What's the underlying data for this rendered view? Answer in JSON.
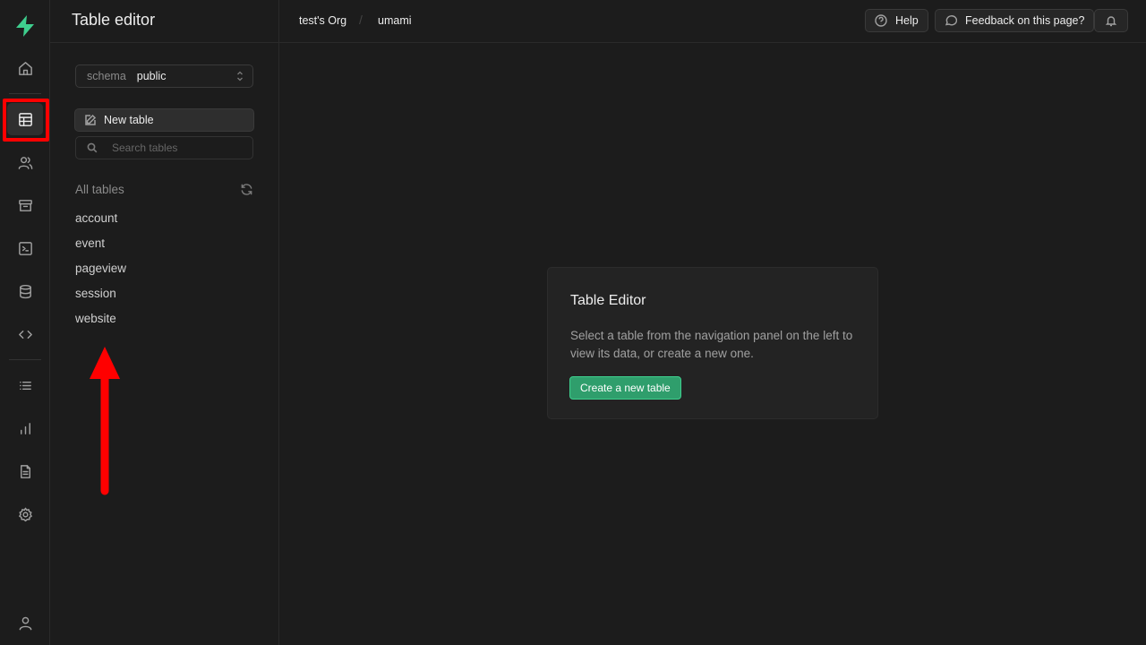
{
  "app": {
    "page_title": "Table editor"
  },
  "breadcrumb": {
    "org": "test's Org",
    "separator": "/",
    "project": "umami"
  },
  "header": {
    "help_label": "Help",
    "feedback_label": "Feedback on this page?"
  },
  "rail": {
    "items": [
      {
        "name": "home-icon"
      },
      {
        "name": "table-editor-icon",
        "active": true
      },
      {
        "name": "users-icon"
      },
      {
        "name": "storage-icon"
      },
      {
        "name": "terminal-icon"
      },
      {
        "name": "database-icon"
      },
      {
        "name": "code-icon"
      },
      {
        "name": "list-icon"
      },
      {
        "name": "reports-icon"
      },
      {
        "name": "document-icon"
      },
      {
        "name": "settings-icon"
      },
      {
        "name": "user-icon"
      }
    ]
  },
  "sidebar": {
    "schema_label": "schema",
    "schema_value": "public",
    "new_table_label": "New table",
    "search_placeholder": "Search tables",
    "all_tables_label": "All tables",
    "tables": [
      "account",
      "event",
      "pageview",
      "session",
      "website"
    ]
  },
  "empty_state": {
    "title": "Table Editor",
    "body": "Select a table from the navigation panel on the left to view its data, or create a new one.",
    "button_label": "Create a new table"
  },
  "colors": {
    "brand": "#3ecf8e",
    "annotation": "#ff0000",
    "background": "#1c1c1c"
  }
}
